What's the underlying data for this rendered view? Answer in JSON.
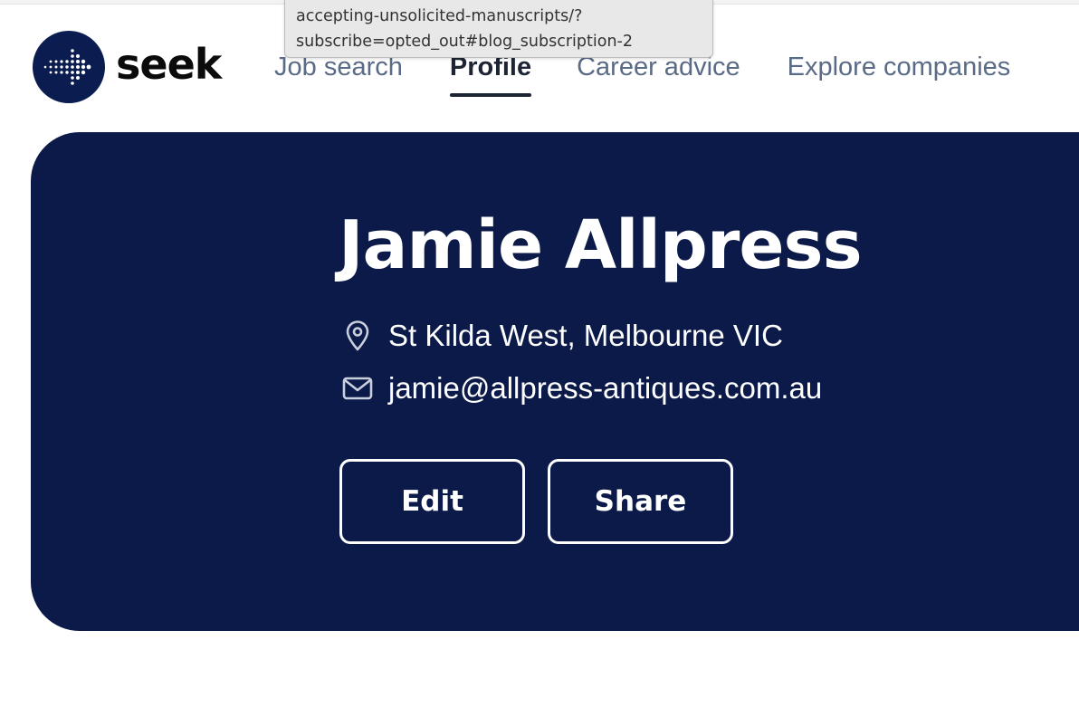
{
  "brand": {
    "name": "seek",
    "color": "#0b1c51"
  },
  "tooltip": {
    "line1": "accepting-unsolicited-manuscripts/?",
    "line2": "subscribe=opted_out#blog_subscription-2"
  },
  "nav": {
    "items": [
      {
        "label": "Job search",
        "active": false
      },
      {
        "label": "Profile",
        "active": true
      },
      {
        "label": "Career advice",
        "active": false
      },
      {
        "label": "Explore companies",
        "active": false
      }
    ]
  },
  "profile": {
    "name": "Jamie Allpress",
    "location": "St Kilda West, Melbourne VIC",
    "email": "jamie@allpress-antiques.com.au",
    "edit_label": "Edit",
    "share_label": "Share",
    "location_icon": "map-pin-icon",
    "email_icon": "envelope-icon",
    "panel_color": "#0b1a49"
  }
}
